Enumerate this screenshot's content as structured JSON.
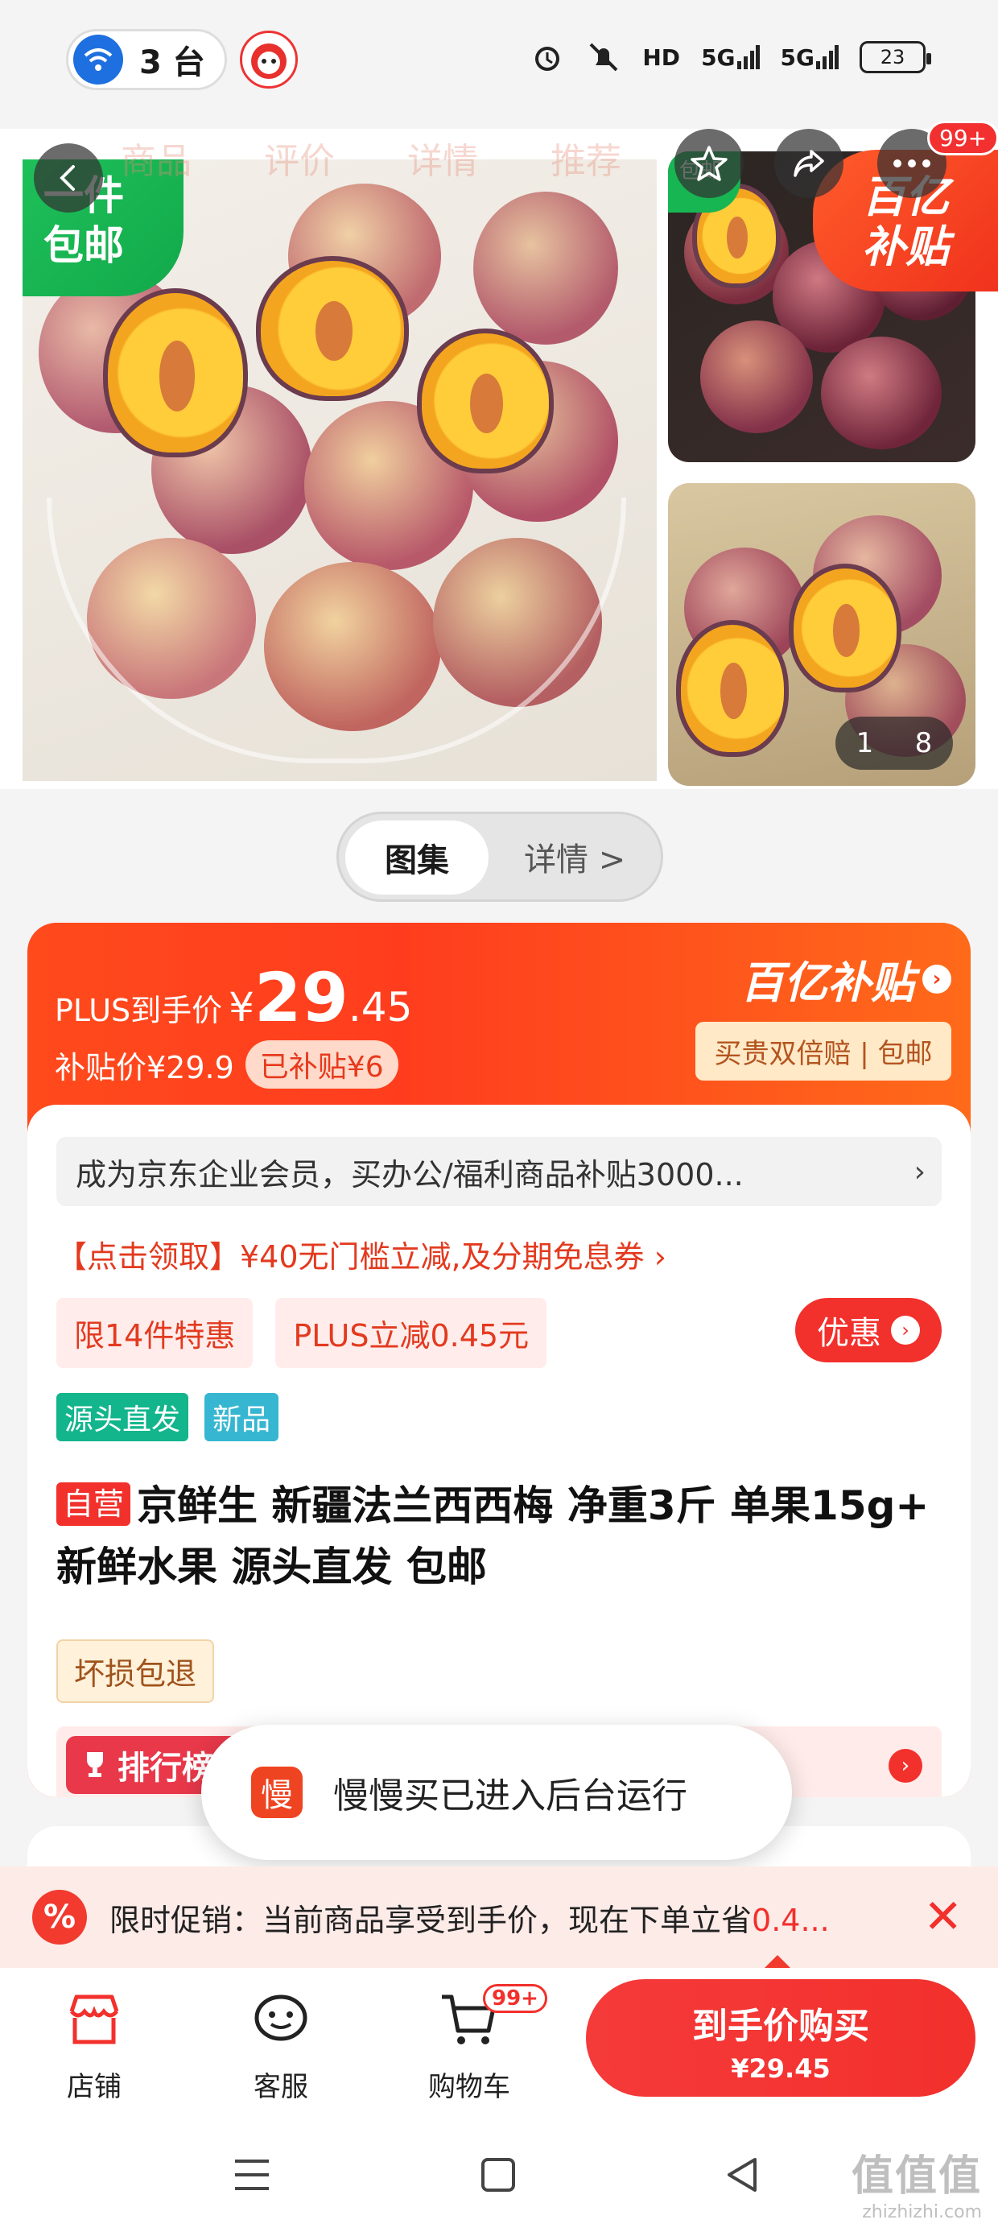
{
  "status_bar": {
    "hotspot_count": "3 台",
    "battery": "23",
    "network_labels": [
      "HD",
      "5G",
      "5G"
    ]
  },
  "gallery": {
    "faded_tabs": [
      "商品",
      "评价",
      "详情",
      "推荐"
    ],
    "free_shipping_badge": "一件\n包邮",
    "free_shipping_small": "包邮",
    "subsidy_badge": "百亿\n补贴",
    "more_count": "99+",
    "page_current": "1",
    "page_total": "8"
  },
  "toggle": {
    "active": "图集",
    "inactive": "详情 >"
  },
  "price": {
    "plus_label": "PLUS到手价",
    "currency": "¥",
    "plus_int": "29",
    "plus_dec": ".45",
    "subsidy_price": "补贴价¥29.9",
    "subsidized_tag": "已补贴¥6",
    "subsidy_logo": "百亿补贴",
    "guarantee": "买贵双倍赔 | 包邮"
  },
  "details": {
    "enterprise_banner": "成为京东企业会员，买办公/福利商品补贴3000...",
    "coupon_text": "【点击领取】¥40无门槛立减,及分期免息券 ›",
    "chips": [
      "限14件特惠",
      "PLUS立减0.45元"
    ],
    "deal_button": "优惠",
    "tags": [
      "源头直发",
      "新品"
    ],
    "self_operated": "自营",
    "product_title": "京鲜生 新疆法兰西西梅 净重3斤 单果15g+ 新鲜水果 源头直发 包邮",
    "damage_tag": "坏损包退",
    "ranking_label": "排行榜"
  },
  "toast": {
    "app_icon_char": "慢",
    "message": "慢慢买已进入后台运行"
  },
  "promo": {
    "icon": "%",
    "text_prefix": "限时促销：当前商品享受到手价，现在下单立省",
    "text_highlight": "0.4..."
  },
  "bottom_bar": {
    "items": [
      "店铺",
      "客服",
      "购物车"
    ],
    "cart_badge": "99+",
    "buy_label": "到手价购买",
    "buy_price": "¥29.45"
  },
  "watermark": {
    "big": "值值值",
    "small": "zhizhizhi.com"
  },
  "colors": {
    "accent": "#f2302c",
    "subsidy_orange": "#ff4a1c",
    "green_badge": "#12a94a"
  }
}
